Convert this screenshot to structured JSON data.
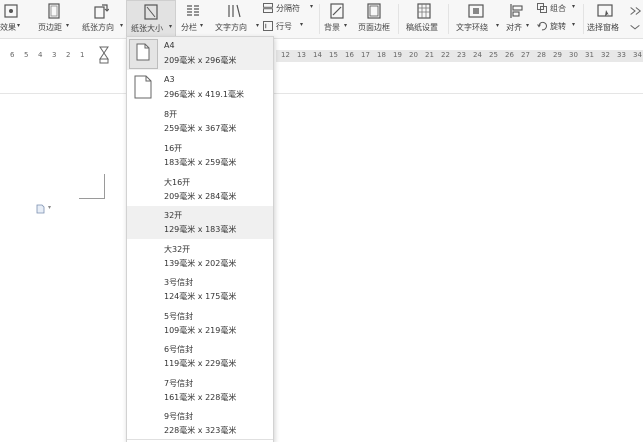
{
  "ribbon": {
    "effects": "效果",
    "margins": "页边距",
    "orientation": "纸张方向",
    "paper_size": "纸张大小",
    "columns": "分栏",
    "text_direction": "文字方向",
    "separator": "分隔符",
    "line_numbers": "行号",
    "background": "背景",
    "page_border": "页面边框",
    "manuscript": "稿纸设置",
    "text_wrap": "文字环绕",
    "align": "对齐",
    "group": "组合",
    "rotate": "旋转",
    "selection_pane": "选择窗格"
  },
  "ruler": {
    "left_ticks": [
      "6",
      "5",
      "4",
      "3",
      "2",
      "1"
    ],
    "right_ticks": [
      "12",
      "13",
      "14",
      "15",
      "16",
      "17",
      "18",
      "19",
      "20",
      "21",
      "22",
      "23",
      "24",
      "25",
      "26",
      "27",
      "28",
      "29",
      "30",
      "31",
      "32",
      "33",
      "34",
      "35"
    ]
  },
  "paper_sizes": [
    {
      "name": "A4",
      "size": "209毫米 x 296毫米"
    },
    {
      "name": "A3",
      "size": "296毫米 x 419.1毫米"
    },
    {
      "name": "8开",
      "size": "259毫米 x 367毫米"
    },
    {
      "name": "16开",
      "size": "183毫米 x 259毫米"
    },
    {
      "name": "大16开",
      "size": "209毫米 x 284毫米"
    },
    {
      "name": "32开",
      "size": "129毫米 x 183毫米"
    },
    {
      "name": "大32开",
      "size": "139毫米 x 202毫米"
    },
    {
      "name": "3号信封",
      "size": "124毫米 x 175毫米"
    },
    {
      "name": "5号信封",
      "size": "109毫米 x 219毫米"
    },
    {
      "name": "6号信封",
      "size": "119毫米 x 229毫米"
    },
    {
      "name": "7号信封",
      "size": "161毫米 x 228毫米"
    },
    {
      "name": "9号信封",
      "size": "228毫米 x 323毫米"
    }
  ]
}
